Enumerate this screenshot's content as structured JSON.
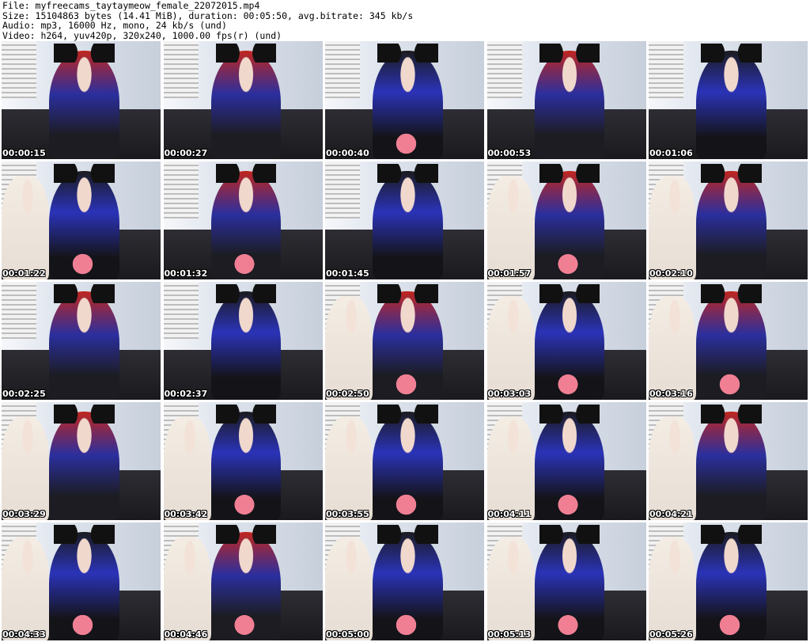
{
  "header": {
    "file_line": "File: myfreecams_taytaymeow_female_22072015.mp4",
    "size_line": "Size: 15104863 bytes (14.41 MiB), duration: 00:05:50, avg.bitrate: 345 kb/s",
    "audio_line": "Audio: mp3, 16000 Hz, mono, 24 kb/s (und)",
    "video_line": "Video: h264, yuv420p, 320x240, 1000.00 fps(r) (und)"
  },
  "thumbnails": [
    {
      "timestamp": "00:00:15",
      "companion": false,
      "alt": false,
      "flower": false
    },
    {
      "timestamp": "00:00:27",
      "companion": false,
      "alt": false,
      "flower": false
    },
    {
      "timestamp": "00:00:40",
      "companion": false,
      "alt": true,
      "flower": true
    },
    {
      "timestamp": "00:00:53",
      "companion": false,
      "alt": false,
      "flower": false
    },
    {
      "timestamp": "00:01:06",
      "companion": false,
      "alt": true,
      "flower": false
    },
    {
      "timestamp": "00:01:22",
      "companion": true,
      "alt": true,
      "flower": true
    },
    {
      "timestamp": "00:01:32",
      "companion": false,
      "alt": false,
      "flower": true
    },
    {
      "timestamp": "00:01:45",
      "companion": false,
      "alt": true,
      "flower": false
    },
    {
      "timestamp": "00:01:57",
      "companion": true,
      "alt": false,
      "flower": true
    },
    {
      "timestamp": "00:02:10",
      "companion": true,
      "alt": false,
      "flower": false
    },
    {
      "timestamp": "00:02:25",
      "companion": false,
      "alt": false,
      "flower": false
    },
    {
      "timestamp": "00:02:37",
      "companion": false,
      "alt": true,
      "flower": false
    },
    {
      "timestamp": "00:02:50",
      "companion": true,
      "alt": false,
      "flower": true
    },
    {
      "timestamp": "00:03:03",
      "companion": true,
      "alt": true,
      "flower": true
    },
    {
      "timestamp": "00:03:16",
      "companion": true,
      "alt": false,
      "flower": true
    },
    {
      "timestamp": "00:03:29",
      "companion": true,
      "alt": false,
      "flower": false
    },
    {
      "timestamp": "00:03:42",
      "companion": true,
      "alt": true,
      "flower": true
    },
    {
      "timestamp": "00:03:55",
      "companion": true,
      "alt": true,
      "flower": true
    },
    {
      "timestamp": "00:04:11",
      "companion": true,
      "alt": true,
      "flower": true
    },
    {
      "timestamp": "00:04:21",
      "companion": true,
      "alt": false,
      "flower": false
    },
    {
      "timestamp": "00:04:33",
      "companion": true,
      "alt": true,
      "flower": true
    },
    {
      "timestamp": "00:04:46",
      "companion": true,
      "alt": false,
      "flower": true
    },
    {
      "timestamp": "00:05:00",
      "companion": true,
      "alt": true,
      "flower": true
    },
    {
      "timestamp": "00:05:13",
      "companion": true,
      "alt": true,
      "flower": true
    },
    {
      "timestamp": "00:05:26",
      "companion": true,
      "alt": true,
      "flower": true
    }
  ],
  "colors": {
    "timestamp_text": "#ffffff",
    "timestamp_outline": "#000000",
    "header_text": "#000000",
    "background": "#ffffff"
  }
}
